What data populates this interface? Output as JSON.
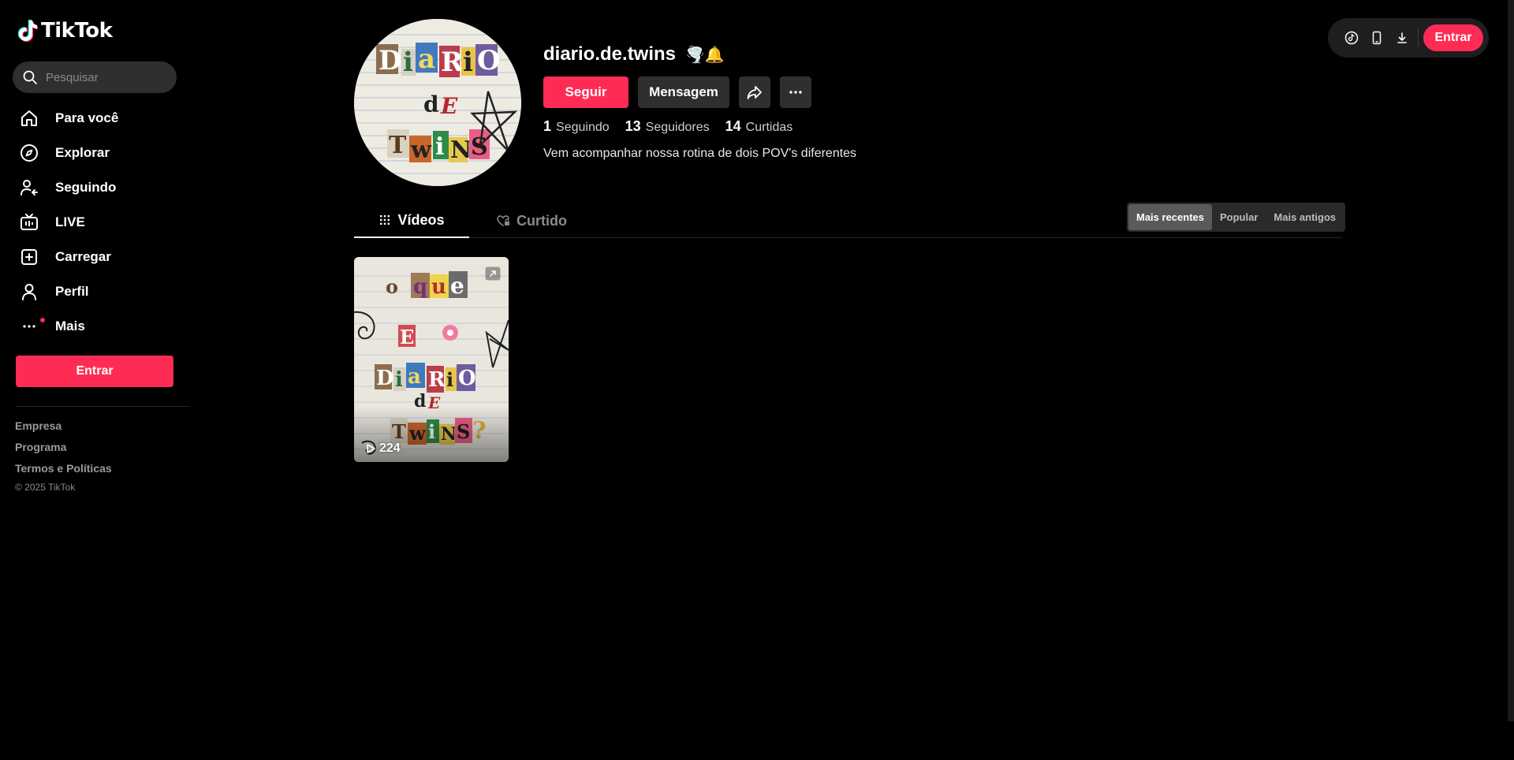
{
  "app": {
    "logo_text": "TikTok"
  },
  "search": {
    "placeholder": "Pesquisar"
  },
  "sidebar": {
    "items": [
      {
        "label": "Para você",
        "icon": "home-icon"
      },
      {
        "label": "Explorar",
        "icon": "compass-icon"
      },
      {
        "label": "Seguindo",
        "icon": "following-icon"
      },
      {
        "label": "LIVE",
        "icon": "live-icon"
      },
      {
        "label": "Carregar",
        "icon": "upload-icon"
      },
      {
        "label": "Perfil",
        "icon": "profile-icon"
      },
      {
        "label": "Mais",
        "icon": "more-icon"
      }
    ],
    "login_label": "Entrar",
    "footer_links": [
      "Empresa",
      "Programa",
      "Termos e Políticas"
    ],
    "copyright": "© 2025 TikTok"
  },
  "topbar": {
    "icons": [
      "tiktok-icon",
      "phone-icon",
      "download-icon"
    ],
    "login_label": "Entrar"
  },
  "profile": {
    "username": "diario.de.twins",
    "username_emoji": "🌪️🔔",
    "avatar_text": [
      "DiaRiO",
      "dE",
      "TwiNS"
    ],
    "follow_label": "Seguir",
    "message_label": "Mensagem",
    "stats": {
      "following": {
        "count": "1",
        "label": "Seguindo"
      },
      "followers": {
        "count": "13",
        "label": "Seguidores"
      },
      "likes": {
        "count": "14",
        "label": "Curtidas"
      }
    },
    "bio": "Vem acompanhar nossa rotina de dois POV's diferentes"
  },
  "tabs": {
    "videos": "Vídeos",
    "liked": "Curtido"
  },
  "sort": {
    "options": [
      "Mais recentes",
      "Popular",
      "Mais antigos"
    ],
    "active": "Mais recentes"
  },
  "videos": [
    {
      "views": "224",
      "thumb_text": [
        "o",
        "que",
        "E",
        "DiaRiO",
        "dE",
        "TwiNS?"
      ]
    }
  ],
  "colors": {
    "accent": "#fe2c55",
    "background": "#000000",
    "surface": "#2f2f2f"
  }
}
